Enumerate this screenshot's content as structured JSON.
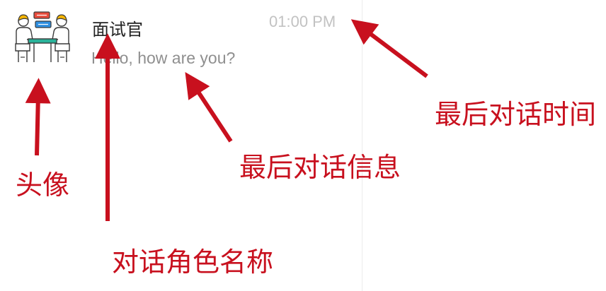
{
  "conversation": {
    "avatar_icon": "interview-meeting-icon",
    "name": "面试官",
    "last_message": "Hello, how are you?",
    "time": "01:00 PM"
  },
  "annotations": {
    "avatar": "头像",
    "role_name": "对话角色名称",
    "last_message": "最后对话信息",
    "last_time": "最后对话时间"
  },
  "colors": {
    "annotation": "#c8101e",
    "name_text": "#222222",
    "message_text": "#8f8f8f",
    "time_text": "#c2c2c2",
    "divider": "#ececec"
  }
}
